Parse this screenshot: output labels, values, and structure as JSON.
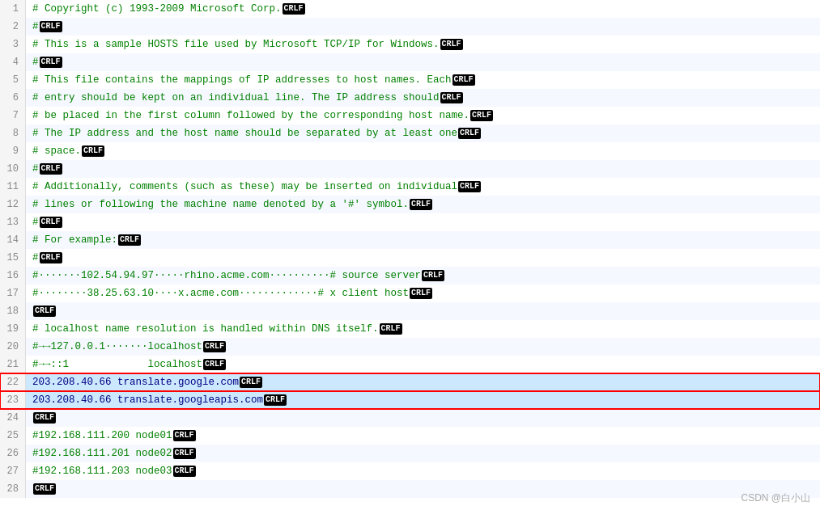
{
  "lines": [
    {
      "num": 1,
      "content": "# Copyright (c) 1993-2009 Microsoft Corp.",
      "crlf": true,
      "type": "comment"
    },
    {
      "num": 2,
      "content": "#",
      "crlf": true,
      "type": "comment"
    },
    {
      "num": 3,
      "content": "# This is a sample HOSTS file used by Microsoft TCP/IP for Windows.",
      "crlf": true,
      "type": "comment"
    },
    {
      "num": 4,
      "content": "#",
      "crlf": true,
      "type": "comment"
    },
    {
      "num": 5,
      "content": "# This file contains the mappings of IP addresses to host names. Each",
      "crlf": true,
      "type": "comment"
    },
    {
      "num": 6,
      "content": "# entry should be kept on an individual line. The IP address should",
      "crlf": true,
      "type": "comment"
    },
    {
      "num": 7,
      "content": "# be placed in the first column followed by the corresponding host name.",
      "crlf": true,
      "type": "comment"
    },
    {
      "num": 8,
      "content": "# The IP address and the host name should be separated by at least one",
      "crlf": true,
      "type": "comment"
    },
    {
      "num": 9,
      "content": "# space.",
      "crlf": true,
      "type": "comment"
    },
    {
      "num": 10,
      "content": "#",
      "crlf": true,
      "type": "comment"
    },
    {
      "num": 11,
      "content": "# Additionally, comments (such as these) may be inserted on individual",
      "crlf": true,
      "type": "comment"
    },
    {
      "num": 12,
      "content": "# lines or following the machine name denoted by a '#' symbol.",
      "crlf": true,
      "type": "comment"
    },
    {
      "num": 13,
      "content": "#",
      "crlf": true,
      "type": "comment"
    },
    {
      "num": 14,
      "content": "# For example:",
      "crlf": true,
      "type": "comment"
    },
    {
      "num": 15,
      "content": "#",
      "crlf": true,
      "type": "comment"
    },
    {
      "num": 16,
      "content": "#·······102.54.94.97·····rhino.acme.com··········# source server",
      "crlf": true,
      "type": "comment"
    },
    {
      "num": 17,
      "content": "#········38.25.63.10····x.acme.com·············# x client host",
      "crlf": true,
      "type": "comment"
    },
    {
      "num": 18,
      "content": "",
      "crlf": true,
      "type": "empty"
    },
    {
      "num": 19,
      "content": "# localhost name resolution is handled within DNS itself.",
      "crlf": true,
      "type": "comment"
    },
    {
      "num": 20,
      "content": "#→→127.0.0.1·······localhost",
      "crlf": true,
      "type": "comment"
    },
    {
      "num": 21,
      "content": "#→→::1             localhost",
      "crlf": true,
      "type": "comment"
    },
    {
      "num": 22,
      "content": "203.208.40.66 translate.google.com",
      "crlf": true,
      "type": "data",
      "boxed": true
    },
    {
      "num": 23,
      "content": "203.208.40.66 translate.googleapis.com",
      "crlf": true,
      "type": "data",
      "boxed": true
    },
    {
      "num": 24,
      "content": "",
      "crlf": true,
      "type": "empty"
    },
    {
      "num": 25,
      "content": "#192.168.111.200 node01",
      "crlf": true,
      "type": "comment"
    },
    {
      "num": 26,
      "content": "#192.168.111.201 node02",
      "crlf": true,
      "type": "comment"
    },
    {
      "num": 27,
      "content": "#192.168.111.203 node03",
      "crlf": true,
      "type": "comment"
    },
    {
      "num": 28,
      "content": "",
      "crlf": true,
      "type": "empty"
    }
  ],
  "watermark": "CSDN @白小山",
  "crlf_label": "CRLF"
}
